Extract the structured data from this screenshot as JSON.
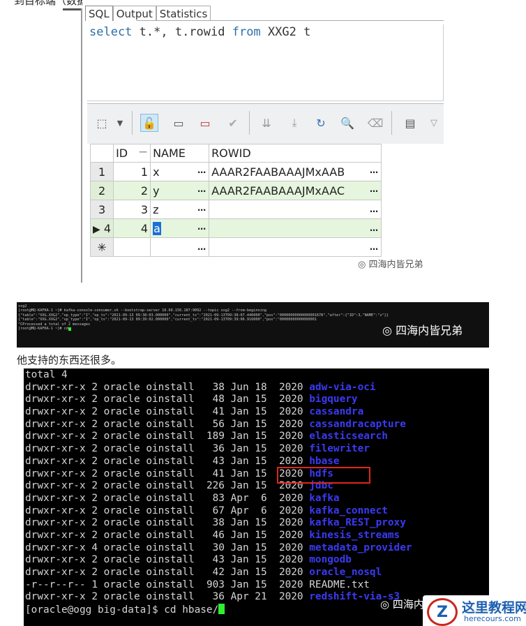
{
  "article": {
    "top_text": "到目标端（数据库和消息队列中，这里是同时）。",
    "mid_text": "他支持的东西还很多。",
    "watermark": "四海内皆兄弟"
  },
  "ide": {
    "tabs": [
      "SQL",
      "Output",
      "Statistics"
    ],
    "sql_keyword1": "select",
    "sql_cols": " t.*, t.rowid ",
    "sql_keyword2": "from",
    "sql_table": " XXG2 t",
    "grid": {
      "headers": [
        "ID",
        "NAME",
        "ROWID"
      ],
      "ellipsis": "…",
      "new_row_marker": "✳",
      "current_row_marker": "▶",
      "rows": [
        {
          "n": "1",
          "id": "1",
          "name": "x",
          "rowid": "AAAR2FAABAAAJMxAAB"
        },
        {
          "n": "2",
          "id": "2",
          "name": "y",
          "rowid": "AAAR2FAABAAAJMxAAC"
        },
        {
          "n": "3",
          "id": "3",
          "name": "z",
          "rowid": ""
        },
        {
          "n": "4",
          "id": "4",
          "name": "a",
          "rowid": ""
        }
      ]
    }
  },
  "kafka_terminal": {
    "lines": [
      "xxg2",
      "[root@MQ-KAFKA-1 ~]# kafka-console-consumer.sh --bootstrap-server 10.60.156.187:9092 --topic xxg2 --from-beginning",
      "{\"table\":\"XXG.XXG2\",\"op_type\":\"I\",\"op_ts\":\"2021-09-13 09:38:03.000000\",\"current_ts\":\"2021-09-13T09:38:07.446000\",\"pos\":\"00000000000000001678\",\"after\":{\"ID\":3,\"NAME\":\"z\"}}",
      "{\"table\":\"XXG.XXG2\",\"op_type\":\"I\",\"op_ts\":\"2021-09-13 09:39:02.000000\",\"current_ts\":\"2021-09-13T09:39:06.916000\",\"pos\":\"00000000000000001",
      "^CProcessed a total of 2 messages",
      "[root@MQ-KAFKA-1 ~]# cd"
    ]
  },
  "ls_terminal": {
    "total": "total 4",
    "rows": [
      {
        "perm": "drwxr-xr-x",
        "links": "2",
        "size": " 38",
        "date": "Jun 18",
        "year": "2020",
        "name": "adw-via-oci"
      },
      {
        "perm": "drwxr-xr-x",
        "links": "2",
        "size": " 48",
        "date": "Jan 15",
        "year": "2020",
        "name": "bigquery"
      },
      {
        "perm": "drwxr-xr-x",
        "links": "2",
        "size": " 41",
        "date": "Jan 15",
        "year": "2020",
        "name": "cassandra"
      },
      {
        "perm": "drwxr-xr-x",
        "links": "2",
        "size": " 56",
        "date": "Jan 15",
        "year": "2020",
        "name": "cassandracapture"
      },
      {
        "perm": "drwxr-xr-x",
        "links": "2",
        "size": "189",
        "date": "Jan 15",
        "year": "2020",
        "name": "elasticsearch"
      },
      {
        "perm": "drwxr-xr-x",
        "links": "2",
        "size": " 36",
        "date": "Jan 15",
        "year": "2020",
        "name": "filewriter"
      },
      {
        "perm": "drwxr-xr-x",
        "links": "2",
        "size": " 43",
        "date": "Jan 15",
        "year": "2020",
        "name": "hbase"
      },
      {
        "perm": "drwxr-xr-x",
        "links": "2",
        "size": " 41",
        "date": "Jan 15",
        "year": "2020",
        "name": "hdfs"
      },
      {
        "perm": "drwxr-xr-x",
        "links": "2",
        "size": "226",
        "date": "Jan 15",
        "year": "2020",
        "name": "jdbc"
      },
      {
        "perm": "drwxr-xr-x",
        "links": "2",
        "size": " 83",
        "date": "Apr  6",
        "year": "2020",
        "name": "kafka"
      },
      {
        "perm": "drwxr-xr-x",
        "links": "2",
        "size": " 67",
        "date": "Apr  6",
        "year": "2020",
        "name": "kafka_connect"
      },
      {
        "perm": "drwxr-xr-x",
        "links": "2",
        "size": " 38",
        "date": "Jan 15",
        "year": "2020",
        "name": "kafka_REST_proxy"
      },
      {
        "perm": "drwxr-xr-x",
        "links": "2",
        "size": " 46",
        "date": "Jan 15",
        "year": "2020",
        "name": "kinesis_streams"
      },
      {
        "perm": "drwxr-xr-x",
        "links": "4",
        "size": " 30",
        "date": "Jan 15",
        "year": "2020",
        "name": "metadata_provider"
      },
      {
        "perm": "drwxr-xr-x",
        "links": "2",
        "size": " 43",
        "date": "Jan 15",
        "year": "2020",
        "name": "mongodb"
      },
      {
        "perm": "drwxr-xr-x",
        "links": "2",
        "size": " 42",
        "date": "Jan 15",
        "year": "2020",
        "name": "oracle_nosql"
      },
      {
        "perm": "-r--r--r--",
        "links": "1",
        "size": "903",
        "date": "Jan 15",
        "year": "2020",
        "name": "README.txt",
        "plain": true
      },
      {
        "perm": "drwxr-xr-x",
        "links": "2",
        "size": " 36",
        "date": "Apr 21",
        "year": "2020",
        "name": "redshift-via-s3"
      }
    ],
    "owner": "oracle",
    "group": "oinstall",
    "prompt": "[oracle@ogg big-data]$ cd hbase/"
  },
  "site_logo": {
    "title": "这里教程网",
    "url": "herecours.com"
  }
}
